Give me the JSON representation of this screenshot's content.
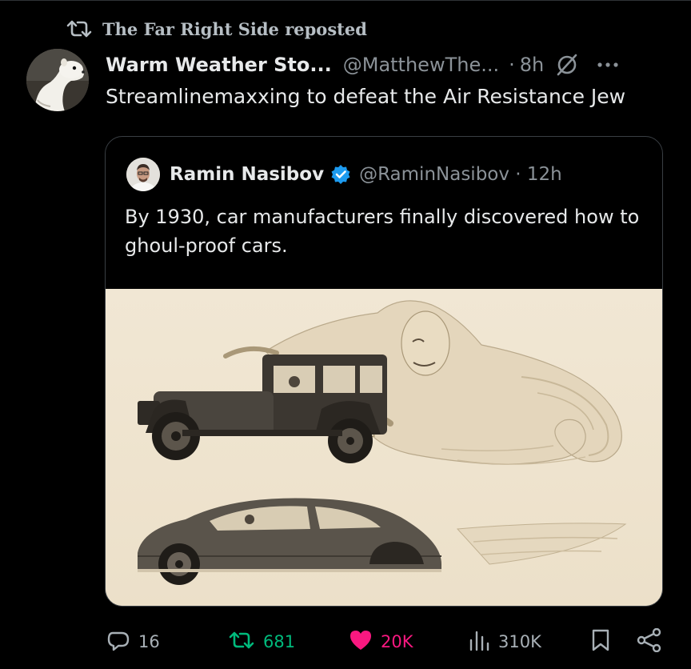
{
  "repost_banner": {
    "label": "The Far Right Side reposted"
  },
  "post": {
    "display_name": "Warm Weather Sto...",
    "handle": "@MatthewThe...",
    "separator": "·",
    "time": "8h",
    "text": "Streamlinemaxxing to defeat the Air Resistance Jew"
  },
  "quote": {
    "display_name": "Ramin Nasibov",
    "handle_time": "@RaminNasibov · 12h",
    "text": "By 1930, car manufacturers finally discovered how to ghoul-proof cars."
  },
  "actions": {
    "replies": "16",
    "reposts": "681",
    "likes": "20K",
    "views": "310K"
  },
  "colors": {
    "background": "#000000",
    "repost_green": "#00ba7c",
    "like_pink": "#f91880",
    "verified_blue": "#1d9bf0",
    "muted": "#8b9298"
  },
  "icons": [
    "retweet-icon",
    "ban-icon",
    "more-icon",
    "verified-badge-icon",
    "reply-icon",
    "heart-icon",
    "views-icon",
    "bookmark-icon",
    "share-icon"
  ]
}
